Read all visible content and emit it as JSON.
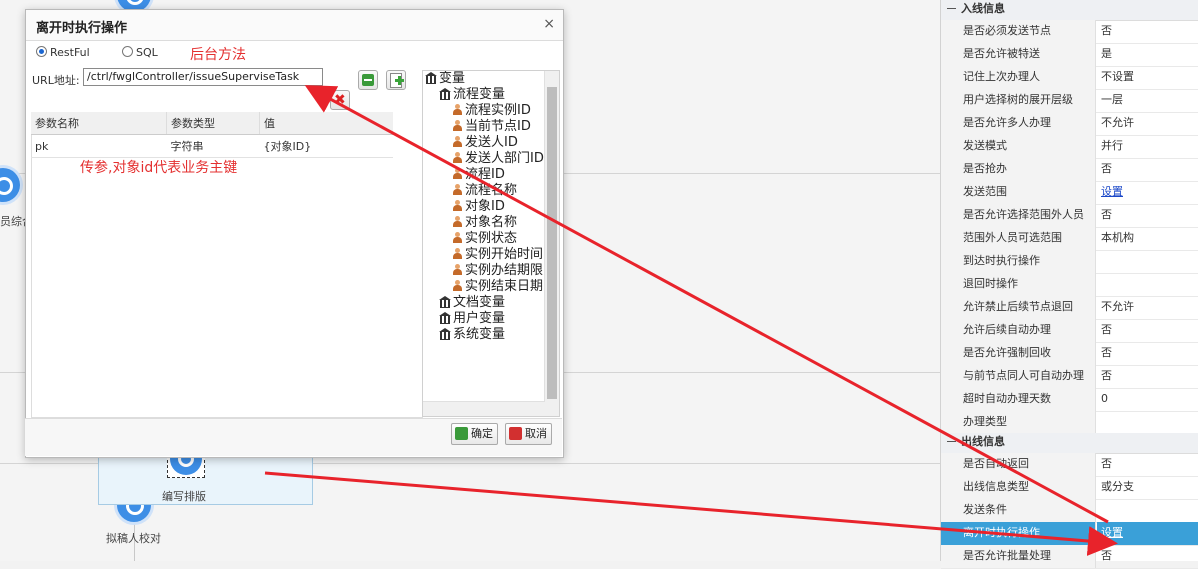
{
  "dialog": {
    "title": "离开时执行操作",
    "close_icon": "×",
    "radio_restful": "RestFul",
    "radio_sql": "SQL",
    "url_label": "URL地址:",
    "url_value": "/ctrl/fwglController/issueSuperviseTask",
    "table_headers": [
      "参数名称",
      "参数类型",
      "值"
    ],
    "params": [
      {
        "name": "pk",
        "type": "字符串",
        "value": "{对象ID}"
      }
    ],
    "ok_label": "确定",
    "cancel_label": "取消"
  },
  "annotations": {
    "backend_method": "后台方法",
    "param_note": "传参,对象id代表业务主键"
  },
  "tree": {
    "root": "变量",
    "flow_vars": "流程变量",
    "flow_items": [
      "流程实例ID",
      "当前节点ID",
      "发送人ID",
      "发送人部门ID",
      "流程ID",
      "流程名称",
      "对象ID",
      "对象名称",
      "实例状态",
      "实例开始时间",
      "实例办结期限",
      "实例结束日期"
    ],
    "doc_vars": "文档变量",
    "user_vars": "用户变量",
    "sys_vars": "系统变量"
  },
  "canvas": {
    "node_partial_label": "员综合",
    "task_label": "编写排版",
    "node_below_label": "拟稿人校对"
  },
  "panel": {
    "group_in": "入线信息",
    "group_out": "出线信息",
    "in_rows": [
      {
        "k": "是否必须发送节点",
        "v": "否"
      },
      {
        "k": "是否允许被特送",
        "v": "是"
      },
      {
        "k": "记住上次办理人",
        "v": "不设置"
      },
      {
        "k": "用户选择树的展开层级",
        "v": "一层"
      },
      {
        "k": "是否允许多人办理",
        "v": "不允许"
      },
      {
        "k": "发送模式",
        "v": "并行"
      },
      {
        "k": "是否抢办",
        "v": "否"
      },
      {
        "k": "发送范围",
        "v": "设置"
      },
      {
        "k": "是否允许选择范围外人员",
        "v": "否"
      },
      {
        "k": "范围外人员可选范围",
        "v": "本机构"
      },
      {
        "k": "到达时执行操作",
        "v": ""
      },
      {
        "k": "退回时操作",
        "v": ""
      },
      {
        "k": "允许禁止后续节点退回",
        "v": "不允许"
      },
      {
        "k": "允许后续自动办理",
        "v": "否"
      },
      {
        "k": "是否允许强制回收",
        "v": "否"
      },
      {
        "k": "与前节点同人可自动办理",
        "v": "否"
      },
      {
        "k": "超时自动办理天数",
        "v": "0"
      },
      {
        "k": "办理类型",
        "v": ""
      }
    ],
    "out_rows": [
      {
        "k": "是否自动返回",
        "v": "否"
      },
      {
        "k": "出线信息类型",
        "v": "或分支"
      },
      {
        "k": "发送条件",
        "v": ""
      },
      {
        "k": "离开时执行操作",
        "v": "设置"
      },
      {
        "k": "是否允许批量处理",
        "v": "否"
      }
    ]
  },
  "colors": {
    "arrow": "#e8232b",
    "selected_row": "#3aa0d8",
    "link": "#1a47c8"
  }
}
